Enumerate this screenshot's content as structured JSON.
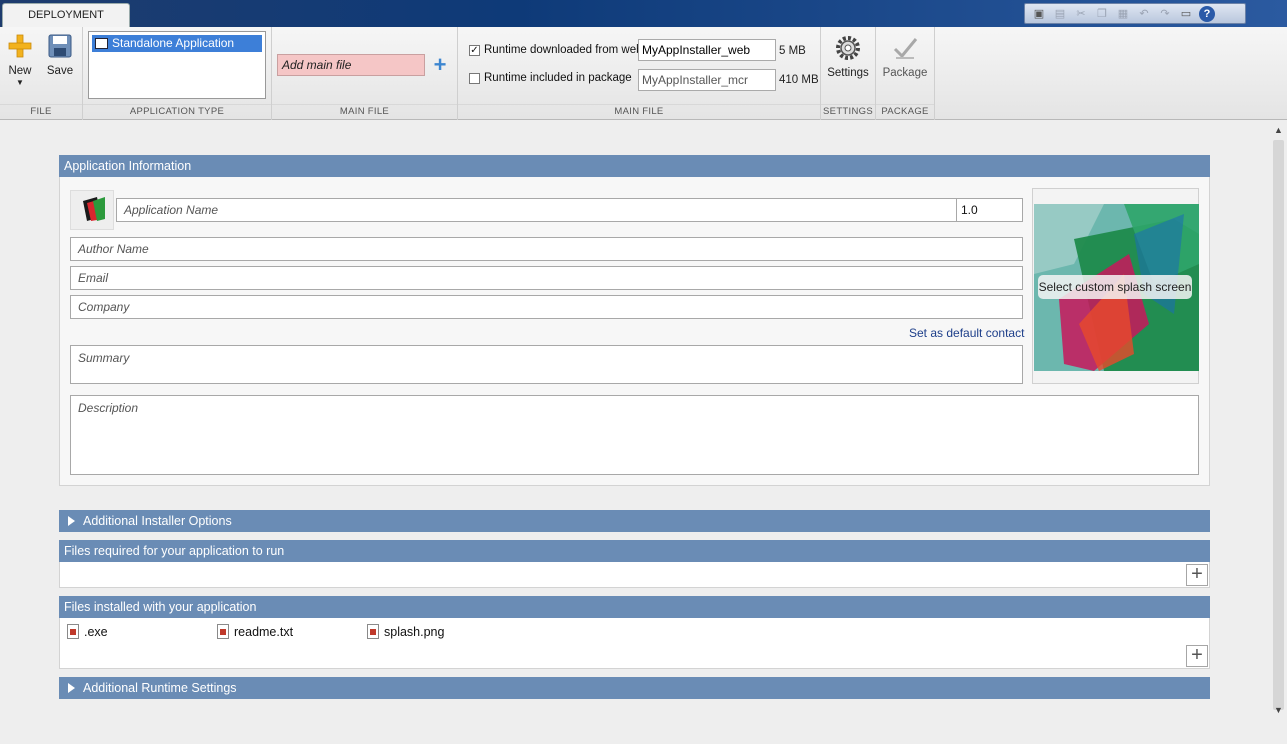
{
  "tabs": {
    "deployment": "DEPLOYMENT"
  },
  "quick_access": {
    "icons": [
      "new-project-icon",
      "save-icon",
      "cut-icon",
      "copy-icon",
      "paste-icon",
      "undo-icon",
      "redo-icon",
      "window-icon",
      "help-icon"
    ],
    "help_glyph": "?"
  },
  "toolstrip": {
    "file": {
      "label": "FILE",
      "new_label": "New",
      "save_label": "Save"
    },
    "application_type": {
      "label": "APPLICATION TYPE",
      "selected": "Standalone Application"
    },
    "main_file": {
      "label": "MAIN FILE",
      "placeholder": "Add main file"
    },
    "runtime": {
      "label": "MAIN FILE",
      "web_label": "Runtime downloaded from web",
      "web_checked": true,
      "web_name": "MyAppInstaller_web",
      "web_size": "5 MB",
      "pkg_label": "Runtime included in package",
      "pkg_checked": false,
      "pkg_name": "MyAppInstaller_mcr",
      "pkg_size": "410 MB"
    },
    "settings": {
      "label": "SETTINGS",
      "button": "Settings"
    },
    "package": {
      "label": "PACKAGE",
      "button": "Package"
    }
  },
  "app_info": {
    "header": "Application Information",
    "app_name_placeholder": "Application Name",
    "version": "1.0",
    "author_placeholder": "Author Name",
    "email_placeholder": "Email",
    "company_placeholder": "Company",
    "default_contact_link": "Set as default contact",
    "summary_placeholder": "Summary",
    "description_placeholder": "Description",
    "splash_label": "Select custom splash screen"
  },
  "sections": {
    "installer_options": "Additional Installer Options",
    "files_required": "Files required for your application to run",
    "files_installed": "Files installed with your application",
    "runtime_settings": "Additional Runtime Settings"
  },
  "installed_files": [
    ".exe",
    "readme.txt",
    "splash.png"
  ],
  "colors": {
    "panel_header": "#6a8cb5",
    "title_bar": "#0e3a78",
    "main_file_missing": "#f5c6c6",
    "selection": "#3d7fd8"
  }
}
